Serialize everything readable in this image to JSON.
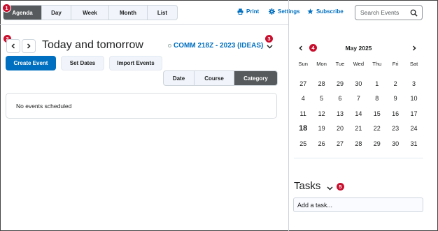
{
  "view_tabs": [
    {
      "label": "Agenda",
      "active": true
    },
    {
      "label": "Day",
      "active": false
    },
    {
      "label": "Week",
      "active": false
    },
    {
      "label": "Month",
      "active": false
    },
    {
      "label": "List",
      "active": false
    }
  ],
  "toplinks": {
    "print": {
      "label": "Print",
      "icon": "printer-icon"
    },
    "settings": {
      "label": "Settings",
      "icon": "gear-icon"
    },
    "subscribe": {
      "label": "Subscribe",
      "icon": "star-icon"
    }
  },
  "search": {
    "placeholder": "Search Events",
    "icon": "search-icon"
  },
  "navigation": {
    "prev_icon": "chevron-left-icon",
    "next_icon": "chevron-right-icon",
    "range_title": "Today and tomorrow"
  },
  "course_selector": {
    "label": "COMM 218Z - 2023 (IDEAS)",
    "icon": "chevron-down-icon"
  },
  "actions": {
    "create_event": "Create Event",
    "set_dates": "Set Dates",
    "import_events": "Import Events"
  },
  "sort_tabs": [
    {
      "label": "Date",
      "active": false
    },
    {
      "label": "Course",
      "active": false
    },
    {
      "label": "Category",
      "active": true
    }
  ],
  "events": {
    "empty_message": "No events scheduled"
  },
  "mini_calendar": {
    "title": "May 2025",
    "days_of_week": [
      "Sun",
      "Mon",
      "Tue",
      "Wed",
      "Thu",
      "Fri",
      "Sat"
    ],
    "weeks": [
      [
        "27",
        "28",
        "29",
        "30",
        "1",
        "2",
        "3"
      ],
      [
        "4",
        "5",
        "6",
        "7",
        "8",
        "9",
        "10"
      ],
      [
        "11",
        "12",
        "13",
        "14",
        "15",
        "16",
        "17"
      ],
      [
        "18",
        "19",
        "20",
        "21",
        "22",
        "23",
        "24"
      ],
      [
        "25",
        "26",
        "27",
        "28",
        "29",
        "30",
        "31"
      ]
    ],
    "today": "18"
  },
  "tasks": {
    "title": "Tasks",
    "input_placeholder": "Add a task..."
  },
  "callouts": [
    "1",
    "2",
    "3",
    "4",
    "5"
  ],
  "colors": {
    "accent": "#006fbf",
    "active_tab": "#565a5c",
    "badge": "#c8102e"
  }
}
